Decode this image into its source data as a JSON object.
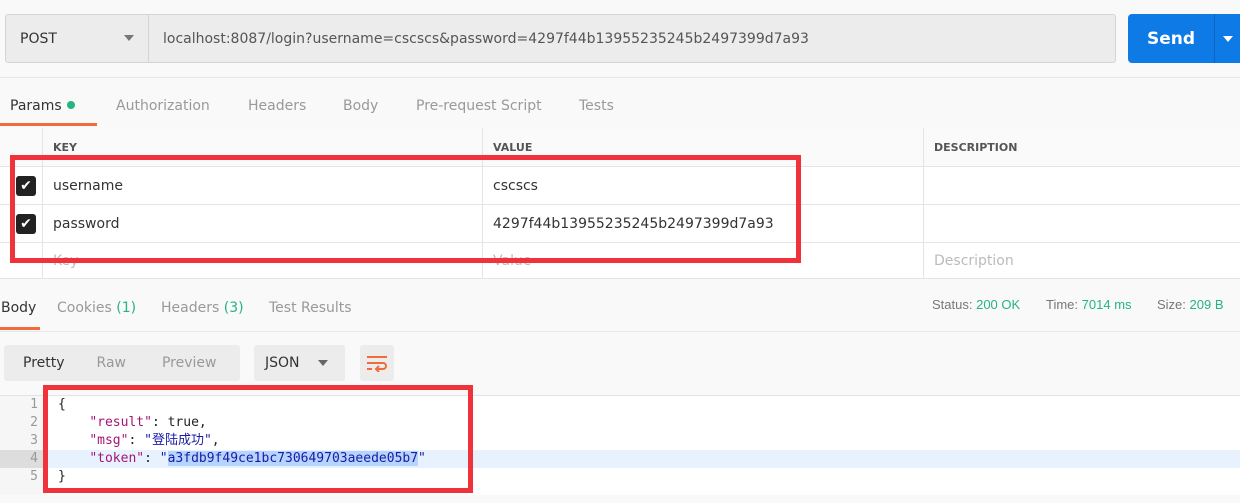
{
  "request": {
    "method": "POST",
    "url": "localhost:8087/login?username=cscscs&password=4297f44b13955235245b2497399d7a93",
    "send_label": "Send"
  },
  "request_tabs": [
    {
      "label": "Params",
      "active": true,
      "indicator": "green-dot"
    },
    {
      "label": "Authorization"
    },
    {
      "label": "Headers"
    },
    {
      "label": "Body"
    },
    {
      "label": "Pre-request Script"
    },
    {
      "label": "Tests"
    }
  ],
  "params": {
    "headers": {
      "key": "KEY",
      "value": "VALUE",
      "description": "DESCRIPTION"
    },
    "rows": [
      {
        "checked": true,
        "key": "username",
        "value": "cscscs",
        "description": ""
      },
      {
        "checked": true,
        "key": "password",
        "value": "4297f44b13955235245b2497399d7a93",
        "description": ""
      }
    ],
    "placeholder": {
      "key": "Key",
      "value": "Value",
      "description": "Description"
    }
  },
  "response_tabs": [
    {
      "label": "Body",
      "active": true
    },
    {
      "label": "Cookies",
      "count": "(1)"
    },
    {
      "label": "Headers",
      "count": "(3)"
    },
    {
      "label": "Test Results"
    }
  ],
  "status": {
    "status_label": "Status:",
    "status": "200 OK",
    "time_label": "Time:",
    "time": "7014 ms",
    "size_label": "Size:",
    "size": "209 B"
  },
  "view": {
    "pretty": "Pretty",
    "raw": "Raw",
    "preview": "Preview",
    "format": "JSON",
    "wrap_icon": "wrap-lines-icon"
  },
  "code": {
    "line_numbers": [
      "1",
      "2",
      "3",
      "4",
      "5"
    ],
    "open": "{",
    "close": "}",
    "result_key": "\"result\"",
    "result_val": "true",
    "msg_key": "\"msg\"",
    "msg_val": "登陆成功",
    "token_key": "\"token\"",
    "token_val": "a3fdb9f49ce1bc730649703aeede05b7"
  },
  "colors": {
    "accent": "#f26b3a",
    "send": "#0e7ae6",
    "success": "#26b47f",
    "highlight": "#f0333a"
  }
}
